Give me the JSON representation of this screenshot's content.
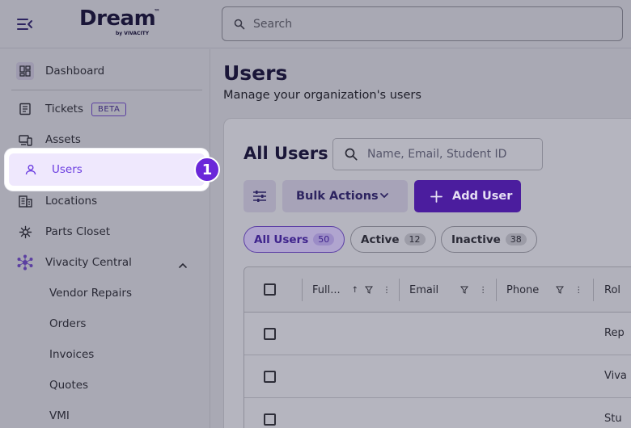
{
  "app": {
    "logo_text": "Dream",
    "logo_tm": "™",
    "logo_byline": "by VIVACITY"
  },
  "search": {
    "placeholder": "Search"
  },
  "sidebar": {
    "items": [
      {
        "label": "Dashboard",
        "icon": "dashboard-icon"
      },
      {
        "label": "Tickets",
        "icon": "ticket-icon",
        "badge": "BETA"
      },
      {
        "label": "Assets",
        "icon": "devices-icon"
      },
      {
        "label": "Users",
        "icon": "user-icon",
        "active": true
      },
      {
        "label": "Locations",
        "icon": "building-icon"
      },
      {
        "label": "Parts Closet",
        "icon": "parts-icon"
      },
      {
        "label": "Vivacity Central",
        "icon": "network-icon",
        "expanded": true
      }
    ],
    "sub_items": [
      "Vendor Repairs",
      "Orders",
      "Invoices",
      "Quotes",
      "VMI"
    ]
  },
  "step_badge": "1",
  "page": {
    "title": "Users",
    "subtitle": "Manage your organization's users"
  },
  "card": {
    "title": "All Users",
    "search_placeholder": "Name, Email, Student ID",
    "bulk_actions_label": "Bulk Actions",
    "add_user_label": "Add User",
    "filters": [
      {
        "label": "All Users",
        "count": "50",
        "active": true
      },
      {
        "label": "Active",
        "count": "12"
      },
      {
        "label": "Inactive",
        "count": "38"
      }
    ]
  },
  "table": {
    "columns": [
      "Full...",
      "Email",
      "Phone",
      "Rol"
    ],
    "rows": [
      {
        "role": "Rep"
      },
      {
        "role": "Viva"
      },
      {
        "role": "Stu"
      }
    ]
  },
  "colors": {
    "accent": "#6a27d9",
    "primary_button": "#4b1d9e",
    "overlay_bg": "#a9a9b4",
    "highlight_bg": "#efe8fd"
  }
}
